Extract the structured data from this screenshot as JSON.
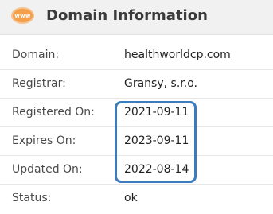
{
  "header": {
    "icon": "www-globe-icon",
    "icon_text": "www",
    "title": "Domain Information",
    "icon_color": "#f4a04a"
  },
  "rows": [
    {
      "label": "Domain:",
      "value": "healthworldcp.com"
    },
    {
      "label": "Registrar:",
      "value": "Gransy, s.r.o."
    },
    {
      "label": "Registered On:",
      "value": "2021-09-11"
    },
    {
      "label": "Expires On:",
      "value": "2023-09-11"
    },
    {
      "label": "Updated On:",
      "value": "2022-08-14"
    },
    {
      "label": "Status:",
      "value": "ok"
    }
  ],
  "highlight": {
    "color": "#3b7bbf"
  }
}
